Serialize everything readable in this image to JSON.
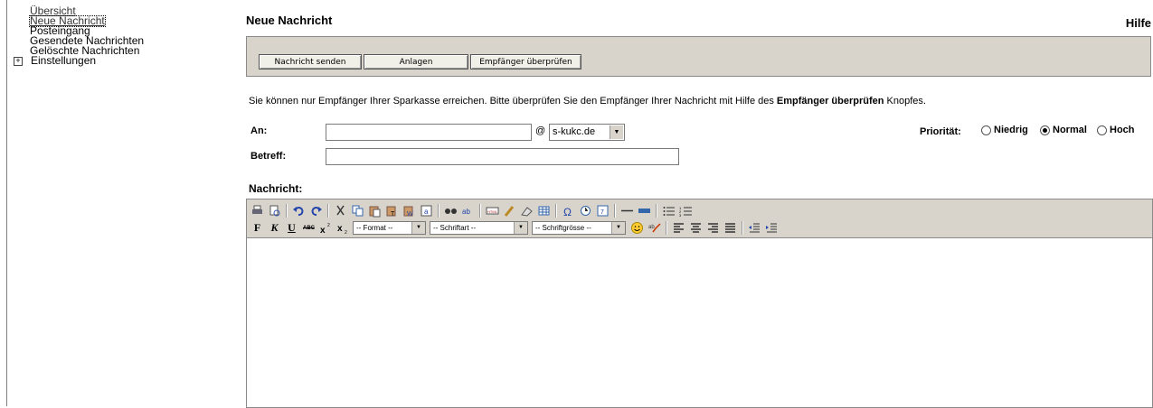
{
  "sidebar": {
    "items": [
      {
        "label": "Übersicht"
      },
      {
        "label": "Neue Nachricht"
      },
      {
        "label": "Posteingang"
      },
      {
        "label": "Gesendete Nachrichten"
      },
      {
        "label": "Gelöschte Nachrichten"
      },
      {
        "label": "Einstellungen",
        "expander": "+"
      }
    ]
  },
  "header": {
    "title": "Neue Nachricht",
    "help": "Hilfe"
  },
  "actions": {
    "send": "Nachricht senden",
    "attachments": "Anlagen",
    "check_recipients": "Empfänger überprüfen"
  },
  "info": {
    "before": "Sie können nur Empfänger Ihrer Sparkasse erreichen. Bitte überprüfen Sie den Empfänger Ihrer Nachricht mit Hilfe des ",
    "bold": "Empfänger überprüfen",
    "after": " Knopfes."
  },
  "form": {
    "to_label": "An:",
    "to_value": "",
    "at": "@",
    "domain": "s-kukc.de",
    "subject_label": "Betreff:",
    "subject_value": "",
    "priority_label": "Priorität:",
    "priority_options": [
      "Niedrig",
      "Normal",
      "Hoch"
    ],
    "priority_selected": "Normal",
    "message_label": "Nachricht:"
  },
  "editor": {
    "bold": "F",
    "italic": "K",
    "underline": "U",
    "strike": "ABC",
    "format": "-- Format --",
    "font": "-- Schriftart --",
    "size": "-- Schriftgrösse --"
  },
  "colors": {
    "toolbar_bg": "#d8d4cc",
    "border": "#8a8a8a"
  }
}
